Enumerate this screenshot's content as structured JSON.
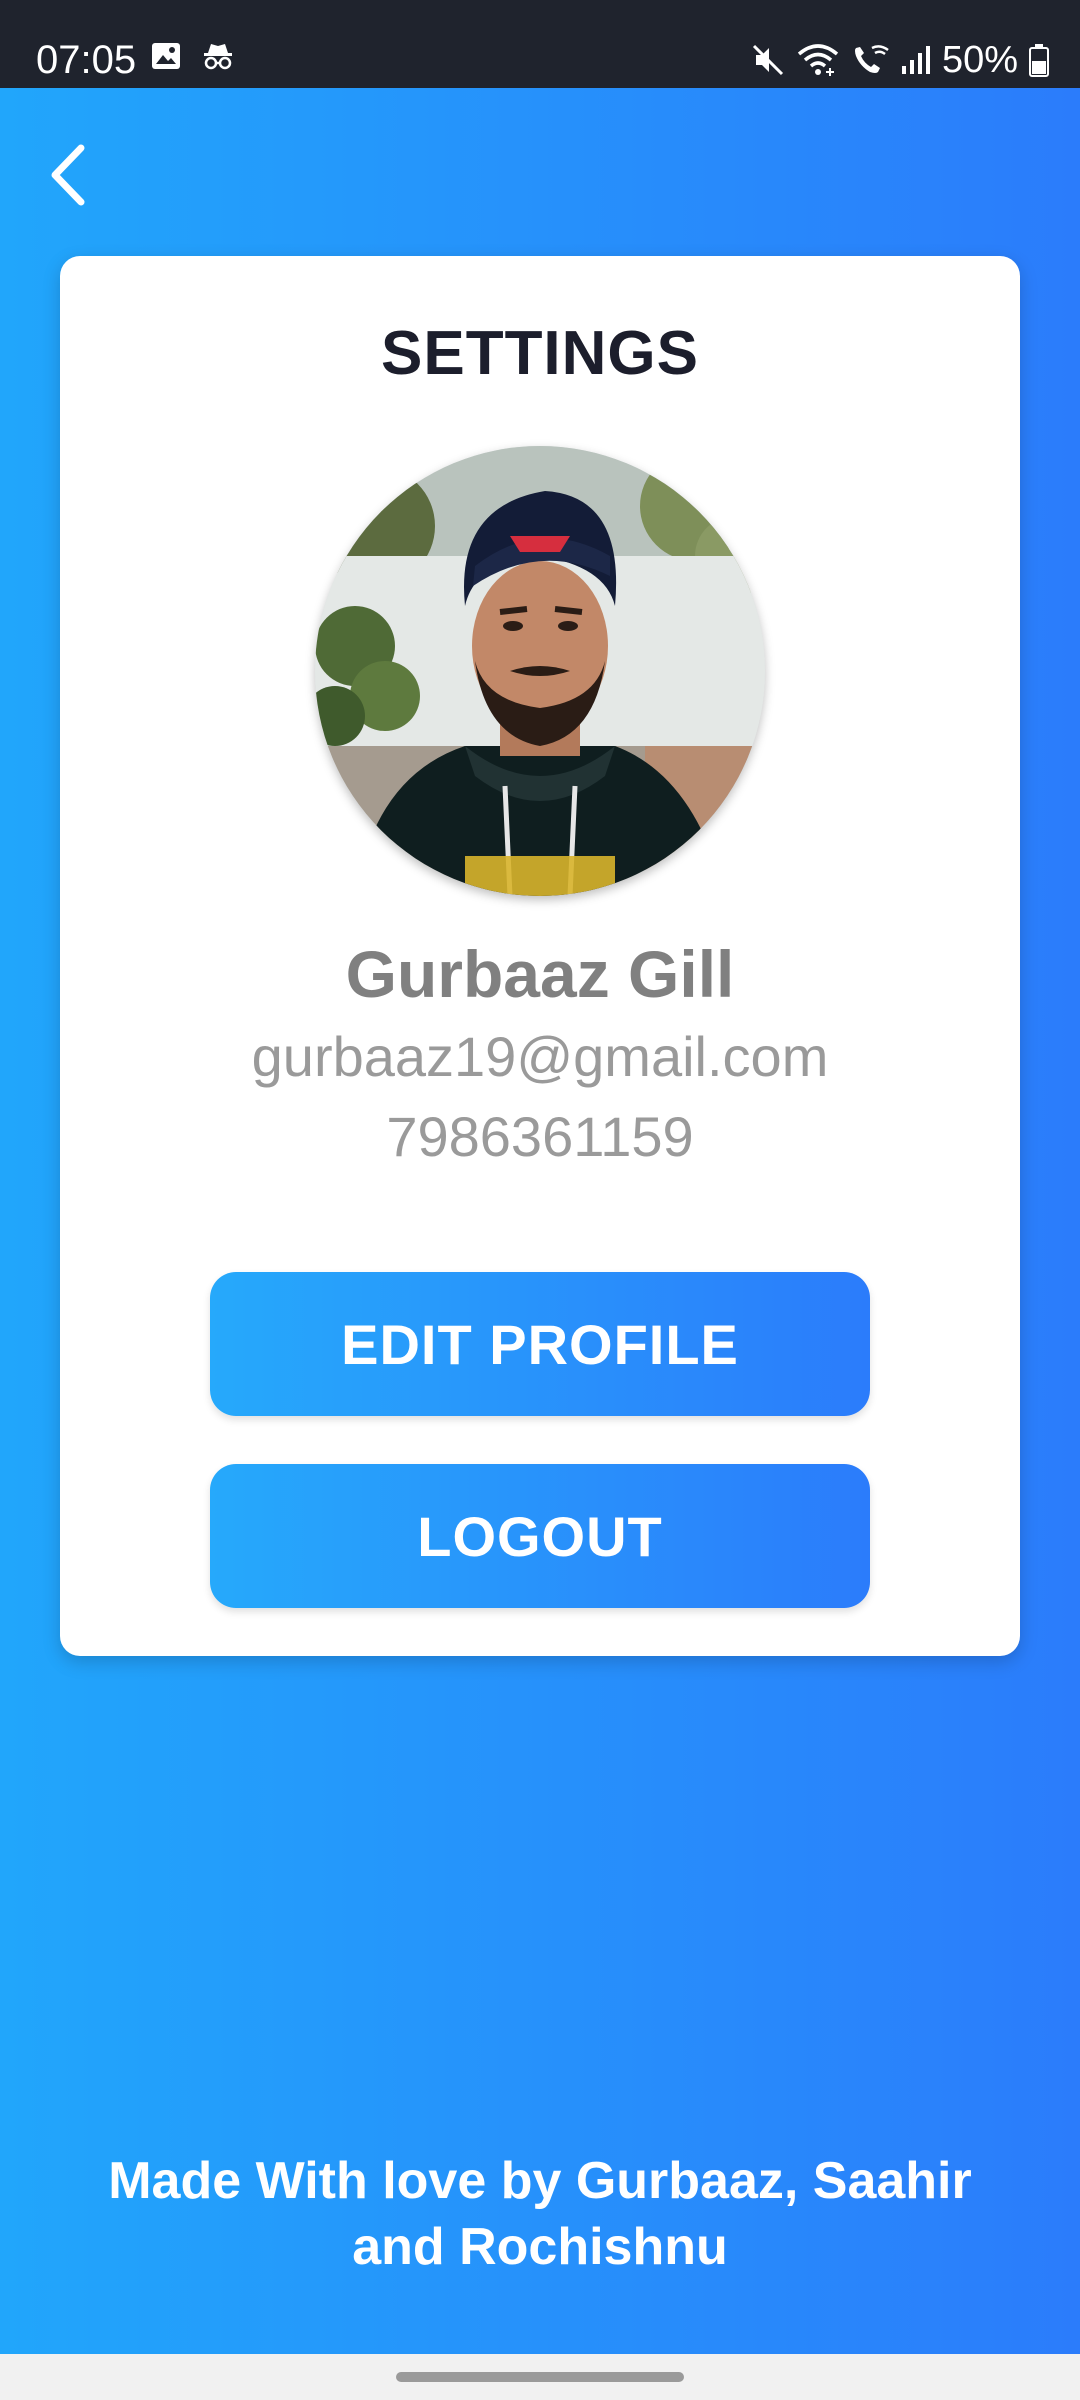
{
  "status_bar": {
    "time": "07:05",
    "battery": "50%",
    "left_icons": [
      "image-icon",
      "incognito-icon"
    ],
    "right_icons": [
      "mute-icon",
      "wifi-icon",
      "wifi-calling-icon",
      "signal-icon",
      "battery-icon"
    ]
  },
  "header": {
    "back_icon": "chevron-left-icon"
  },
  "settings": {
    "title": "SETTINGS",
    "user": {
      "name": "Gurbaaz Gill",
      "email": "gurbaaz19@gmail.com",
      "phone": "7986361159"
    },
    "edit_button": "EDIT PROFILE",
    "logout_button": "LOGOUT"
  },
  "footer": {
    "line1": "Made With love by Gurbaaz, Saahir",
    "line2": "and Rochishnu"
  },
  "colors": {
    "gradient_start": "#21a6fb",
    "gradient_end": "#2b7cfb",
    "status_bar": "#1f232d",
    "title": "#1c1e2c",
    "muted_text": "#808080"
  }
}
